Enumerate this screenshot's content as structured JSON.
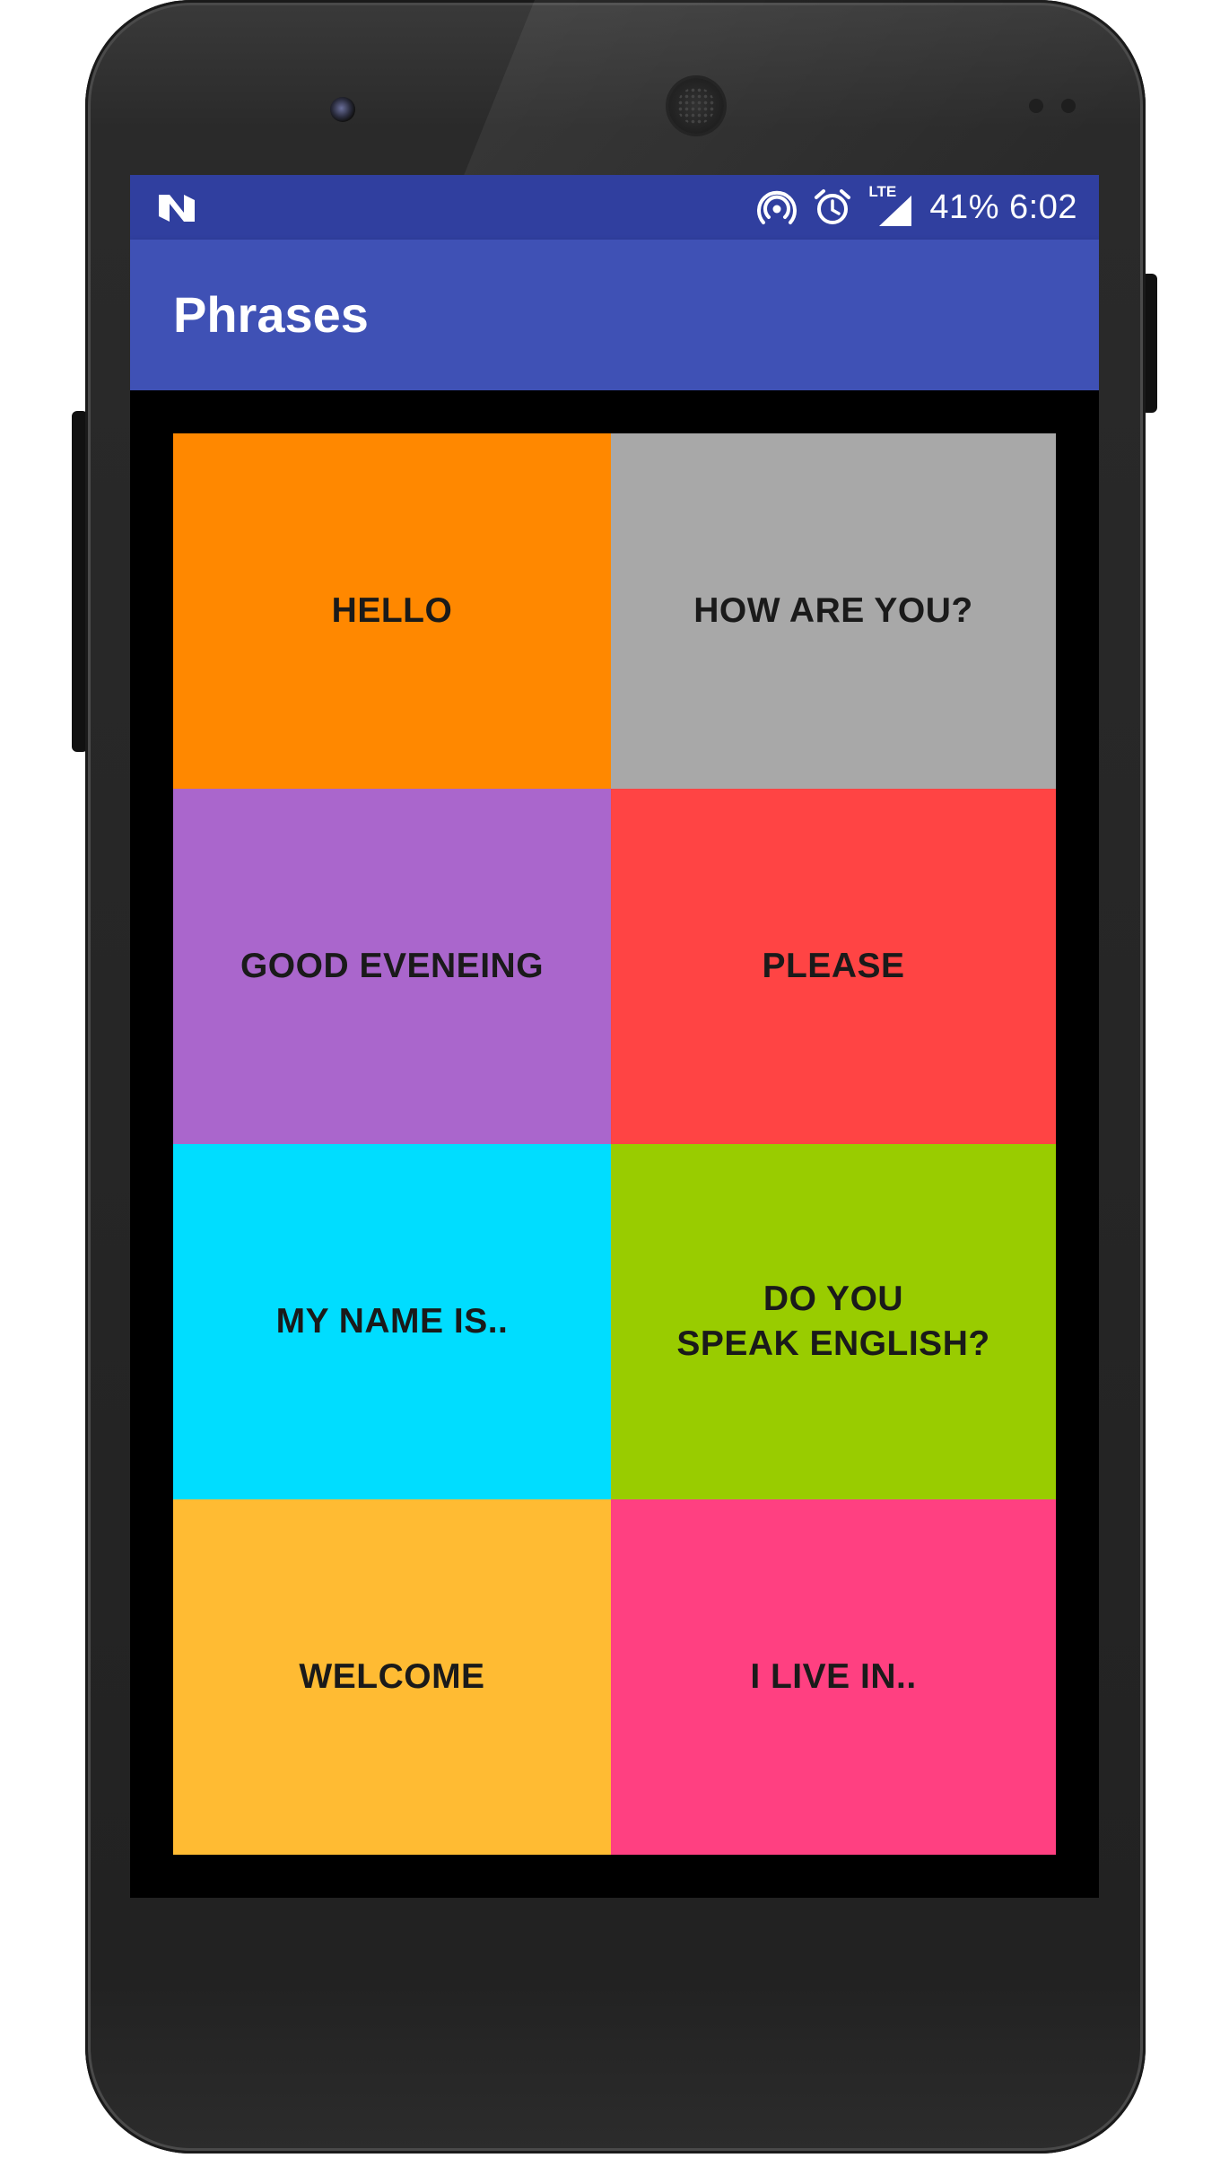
{
  "app": {
    "title": "Phrases"
  },
  "status_bar": {
    "left_icon": "n-notification-icon",
    "icons": [
      "hotspot-icon",
      "alarm-icon",
      "lte-signal-icon"
    ],
    "lte_label": "LTE",
    "text": "41% 6:02",
    "color": "#303f9f"
  },
  "colors": {
    "app_bar": "#3f51b5",
    "background": "#000000"
  },
  "phrases": [
    {
      "label": "HELLO",
      "color": "#ff8800"
    },
    {
      "label": "HOW ARE YOU?",
      "color": "#a8a8a8"
    },
    {
      "label": "GOOD EVENEING",
      "color": "#aa66cc"
    },
    {
      "label": "PLEASE",
      "color": "#ff4444"
    },
    {
      "label": "MY NAME IS..",
      "color": "#00ddff"
    },
    {
      "label": "DO YOU\nSPEAK ENGLISH?",
      "color": "#99cc00"
    },
    {
      "label": "WELCOME",
      "color": "#ffbb33"
    },
    {
      "label": "I LIVE IN..",
      "color": "#ff4081"
    }
  ]
}
